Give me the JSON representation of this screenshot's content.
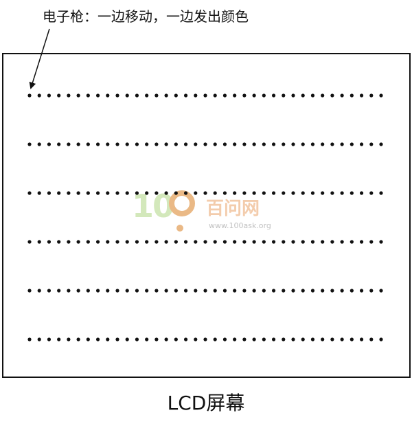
{
  "annotation": {
    "text": "电子枪：一边移动，一边发出颜色"
  },
  "caption": {
    "text": "LCD屏幕"
  },
  "watermark": {
    "digits": "10",
    "name": "百问网",
    "url": "www.100ask.org"
  },
  "screen": {
    "rows": 6,
    "dots_per_row": 37
  },
  "colors": {
    "ink": "#111111",
    "watermark_green": "#cfe6b4",
    "watermark_orange": "#f2c7a4"
  }
}
